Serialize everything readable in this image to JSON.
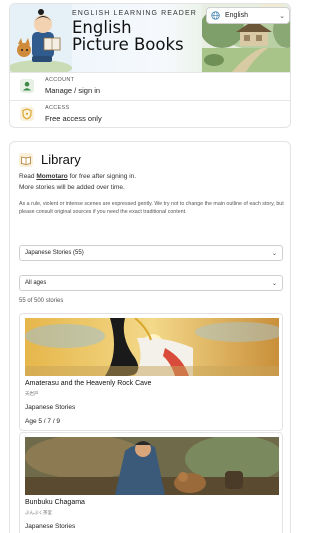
{
  "header": {
    "eyebrow": "ENGLISH LEARNING READER",
    "title_line1": "English",
    "title_line2": "Picture Books",
    "language": "English"
  },
  "account": {
    "label": "ACCOUNT",
    "value": "Manage / sign in",
    "icon": "user-icon"
  },
  "access": {
    "label": "ACCESS",
    "value": "Free access only",
    "icon": "shield-icon"
  },
  "library": {
    "title": "Library",
    "intro_prefix": "Read ",
    "intro_link": "Momotaro",
    "intro_suffix": " for free after signing in.",
    "more": "More stories will be added over time.",
    "note": "As a rule, violent or intense scenes are expressed gently. We try not to change the main outline of each story, but please consult original sources if you need the exact traditional content.",
    "category_select": "Japanese Stories (55)",
    "age_select": "All ages",
    "count": "55 of 500 stories"
  },
  "stories": [
    {
      "title": "Amaterasu and the Heavenly Rock Cave",
      "jp": "天岩戸",
      "category": "Japanese Stories",
      "age": "Age 5 / 7 / 9"
    },
    {
      "title": "Bunbuku Chagama",
      "jp": "ぶんぶく茶釜",
      "category": "Japanese Stories",
      "age": ""
    }
  ],
  "colors": {
    "accent_green": "#3b8a4a",
    "accent_gold": "#d9a52a"
  }
}
